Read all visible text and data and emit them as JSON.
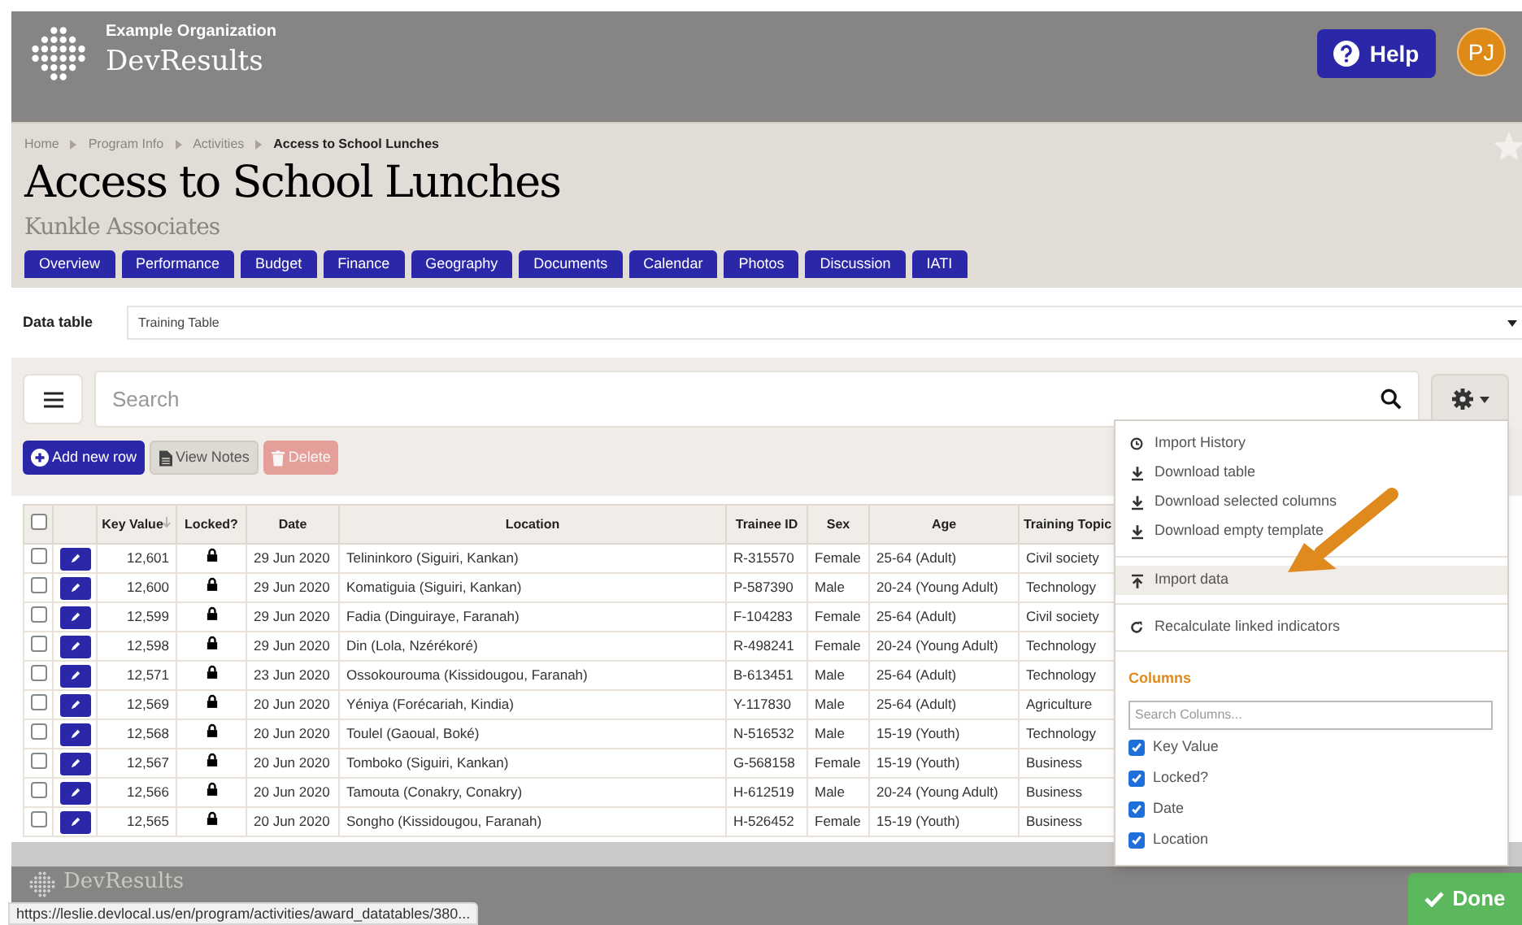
{
  "header": {
    "organization": "Example Organization",
    "app_name": "DevResults",
    "help": "Help",
    "avatar": "PJ"
  },
  "breadcrumbs": [
    {
      "label": "Home",
      "current": false
    },
    {
      "label": "Program Info",
      "current": false
    },
    {
      "label": "Activities",
      "current": false
    },
    {
      "label": "Access to School Lunches",
      "current": true
    }
  ],
  "title": "Access to School Lunches",
  "subtitle": "Kunkle Associates",
  "tabs": [
    "Overview",
    "Performance",
    "Budget",
    "Finance",
    "Geography",
    "Documents",
    "Calendar",
    "Photos",
    "Discussion",
    "IATI"
  ],
  "data_table": {
    "label": "Data table",
    "value": "Training Table"
  },
  "search": {
    "placeholder": "Search"
  },
  "actions": [
    {
      "kind": "add",
      "label": "Add new row",
      "disabled": false
    },
    {
      "kind": "notes",
      "label": "View Notes",
      "disabled": false
    },
    {
      "kind": "delete",
      "label": "Delete",
      "disabled": true
    }
  ],
  "table": {
    "select_all": {
      "checked": false
    },
    "columns": [
      {
        "label": "Key Value",
        "sorted": true
      },
      {
        "label": "Locked?",
        "sorted": false
      },
      {
        "label": "Date",
        "sorted": false
      },
      {
        "label": "Location",
        "sorted": false
      },
      {
        "label": "Trainee ID",
        "sorted": false
      },
      {
        "label": "Sex",
        "sorted": false
      },
      {
        "label": "Age",
        "sorted": false
      },
      {
        "label": "Training Topic",
        "sorted": false
      }
    ],
    "rows": [
      {
        "checked": false,
        "locked": true,
        "cells": [
          "12,601",
          "",
          "29 Jun 2020",
          "Telininkoro (Siguiri, Kankan)",
          "R-315570",
          "Female",
          "25-64 (Adult)",
          "Civil society"
        ]
      },
      {
        "checked": false,
        "locked": true,
        "cells": [
          "12,600",
          "",
          "29 Jun 2020",
          "Komatiguia (Siguiri, Kankan)",
          "P-587390",
          "Male",
          "20-24 (Young Adult)",
          "Technology"
        ]
      },
      {
        "checked": false,
        "locked": true,
        "cells": [
          "12,599",
          "",
          "29 Jun 2020",
          "Fadia (Dinguiraye, Faranah)",
          "F-104283",
          "Female",
          "25-64 (Adult)",
          "Civil society"
        ]
      },
      {
        "checked": false,
        "locked": true,
        "cells": [
          "12,598",
          "",
          "29 Jun 2020",
          "Din (Lola, Nzérékoré)",
          "R-498241",
          "Female",
          "20-24 (Young Adult)",
          "Technology"
        ]
      },
      {
        "checked": false,
        "locked": true,
        "cells": [
          "12,571",
          "",
          "23 Jun 2020",
          "Ossokourouma (Kissidougou, Faranah)",
          "B-613451",
          "Male",
          "25-64 (Adult)",
          "Technology"
        ]
      },
      {
        "checked": false,
        "locked": true,
        "cells": [
          "12,569",
          "",
          "20 Jun 2020",
          "Yéniya (Forécariah, Kindia)",
          "Y-117830",
          "Male",
          "25-64 (Adult)",
          "Agriculture"
        ]
      },
      {
        "checked": false,
        "locked": true,
        "cells": [
          "12,568",
          "",
          "20 Jun 2020",
          "Toulel (Gaoual, Boké)",
          "N-516532",
          "Male",
          "15-19 (Youth)",
          "Technology"
        ]
      },
      {
        "checked": false,
        "locked": true,
        "cells": [
          "12,567",
          "",
          "20 Jun 2020",
          "Tomboko (Siguiri, Kankan)",
          "G-568158",
          "Female",
          "15-19 (Youth)",
          "Business"
        ]
      },
      {
        "checked": false,
        "locked": true,
        "cells": [
          "12,566",
          "",
          "20 Jun 2020",
          "Tamouta (Conakry, Conakry)",
          "H-612519",
          "Male",
          "20-24 (Young Adult)",
          "Business"
        ]
      },
      {
        "checked": false,
        "locked": true,
        "cells": [
          "12,565",
          "",
          "20 Jun 2020",
          "Songho (Kissidougou, Faranah)",
          "H-526452",
          "Female",
          "15-19 (Youth)",
          "Business"
        ]
      }
    ]
  },
  "menu": {
    "groups": [
      [
        {
          "kind": "history",
          "label": "Import History",
          "highlighted": false
        },
        {
          "kind": "download",
          "label": "Download table",
          "highlighted": false
        },
        {
          "kind": "download",
          "label": "Download selected columns",
          "highlighted": false
        },
        {
          "kind": "download",
          "label": "Download empty template",
          "highlighted": false
        }
      ],
      [
        {
          "kind": "upload",
          "label": "Import data",
          "highlighted": true
        }
      ],
      [
        {
          "kind": "refresh",
          "label": "Recalculate linked indicators",
          "highlighted": false
        }
      ]
    ],
    "columns_title": "Columns",
    "columns_search": {
      "placeholder": "Search Columns..."
    },
    "column_options": [
      {
        "label": "Key Value",
        "checked": true
      },
      {
        "label": "Locked?",
        "checked": true
      },
      {
        "label": "Date",
        "checked": true
      },
      {
        "label": "Location",
        "checked": true
      }
    ]
  },
  "footer": {
    "app_name": "DevResults",
    "done": "Done"
  },
  "status_url": "https://leslie.devlocal.us/en/program/activities/award_datatables/380..."
}
